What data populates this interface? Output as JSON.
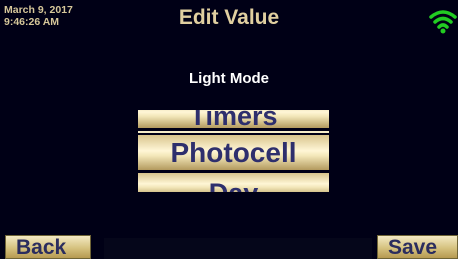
{
  "header": {
    "date": "March 9, 2017",
    "time": "9:46:26 AM",
    "title": "Edit Value",
    "wifi_icon": "wifi-signal-icon",
    "wifi_color": "#22cc22"
  },
  "editor": {
    "label": "Light Mode",
    "options": [
      "Timers",
      "Photocell",
      "Day"
    ],
    "selected": "Photocell"
  },
  "footer": {
    "back_label": "Back",
    "save_label": "Save"
  }
}
